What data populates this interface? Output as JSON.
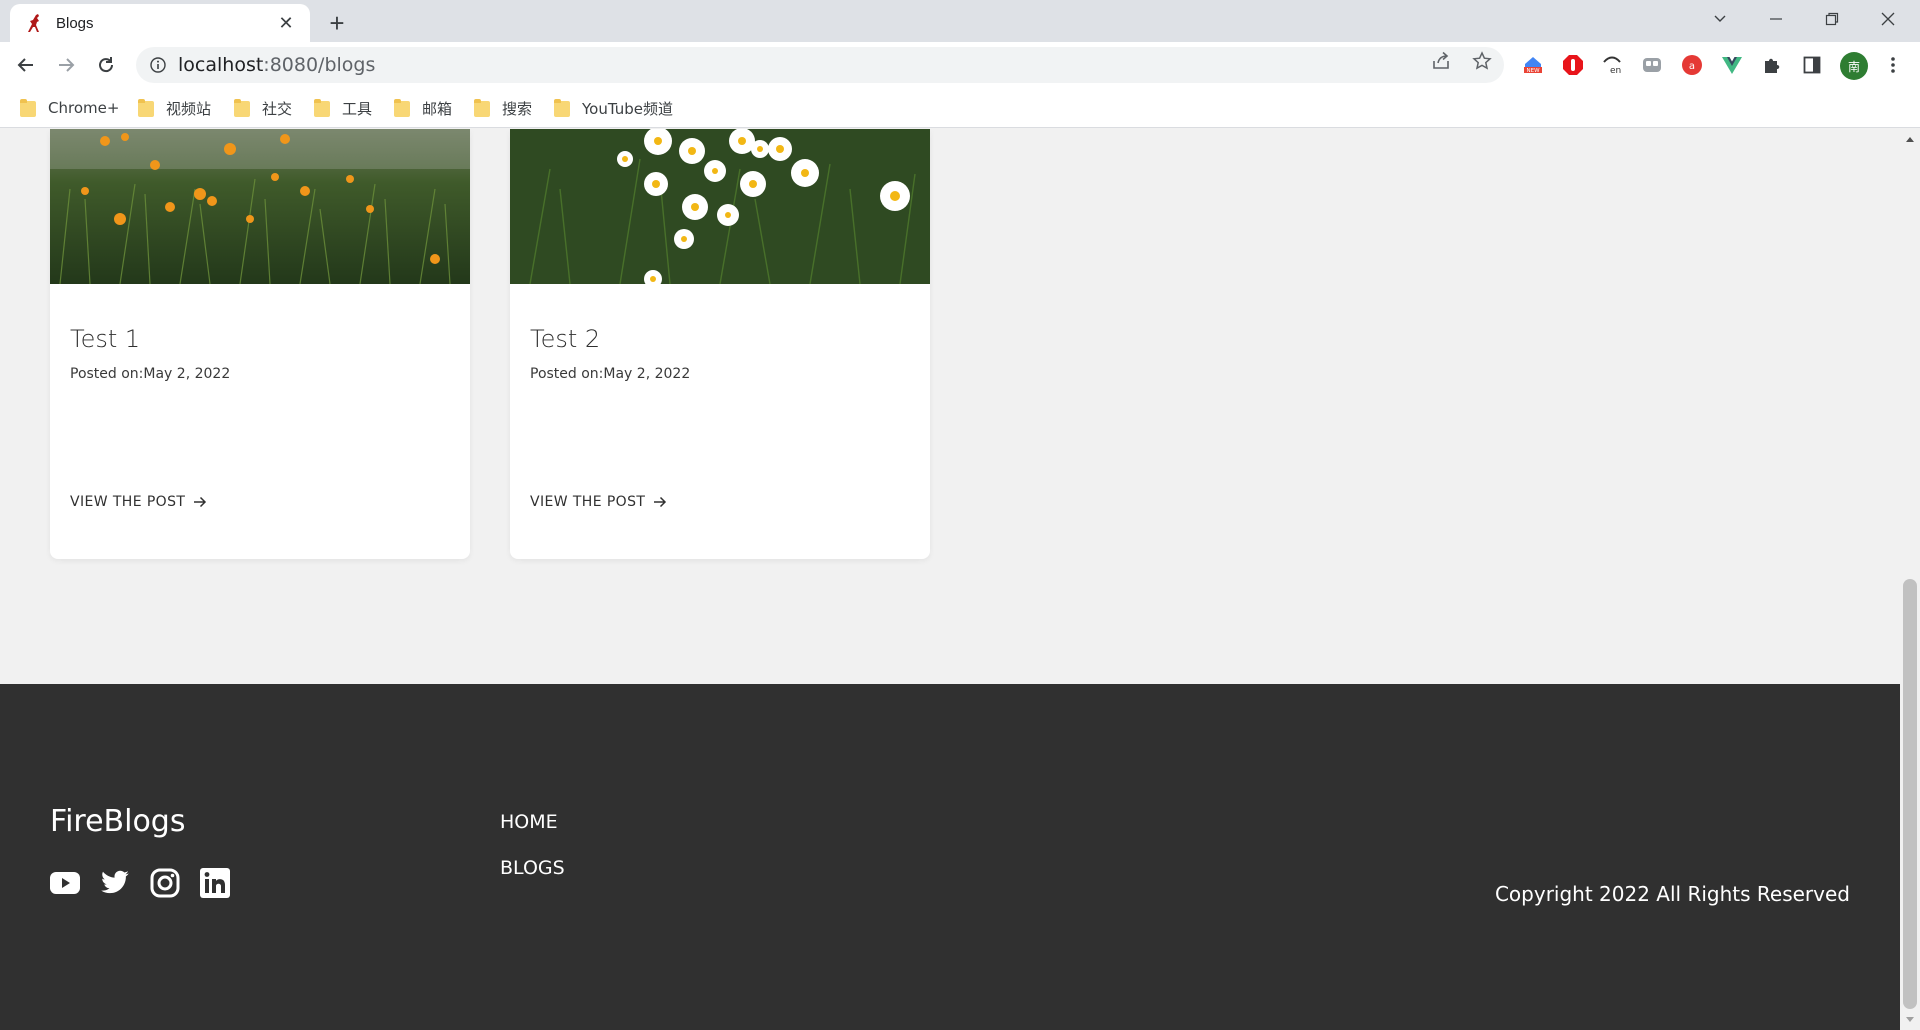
{
  "browser": {
    "tab_title": "Blogs",
    "url_host": "localhost",
    "url_rest": ":8080/blogs",
    "profile_initial": "南"
  },
  "bookmarks": [
    {
      "label": "Chrome+"
    },
    {
      "label": "视频站"
    },
    {
      "label": "社交"
    },
    {
      "label": "工具"
    },
    {
      "label": "邮箱"
    },
    {
      "label": "搜索"
    },
    {
      "label": "YouTube频道"
    }
  ],
  "posts": [
    {
      "title": "Test 1",
      "date": "Posted on:May 2, 2022",
      "link": "VIEW THE POST",
      "image": "orange-flowers-photo"
    },
    {
      "title": "Test 2",
      "date": "Posted on:May 2, 2022",
      "link": "VIEW THE POST",
      "image": "daisies-photo"
    }
  ],
  "footer": {
    "brand": "FireBlogs",
    "socials": [
      "youtube-icon",
      "twitter-icon",
      "instagram-icon",
      "linkedin-icon"
    ],
    "links": [
      {
        "label": "HOME"
      },
      {
        "label": "BLOGS"
      }
    ],
    "copyright": "Copyright 2022 All Rights Reserved"
  },
  "colors": {
    "footer_bg": "#303030",
    "page_bg": "#f1f1f1",
    "card_bg": "#ffffff"
  }
}
